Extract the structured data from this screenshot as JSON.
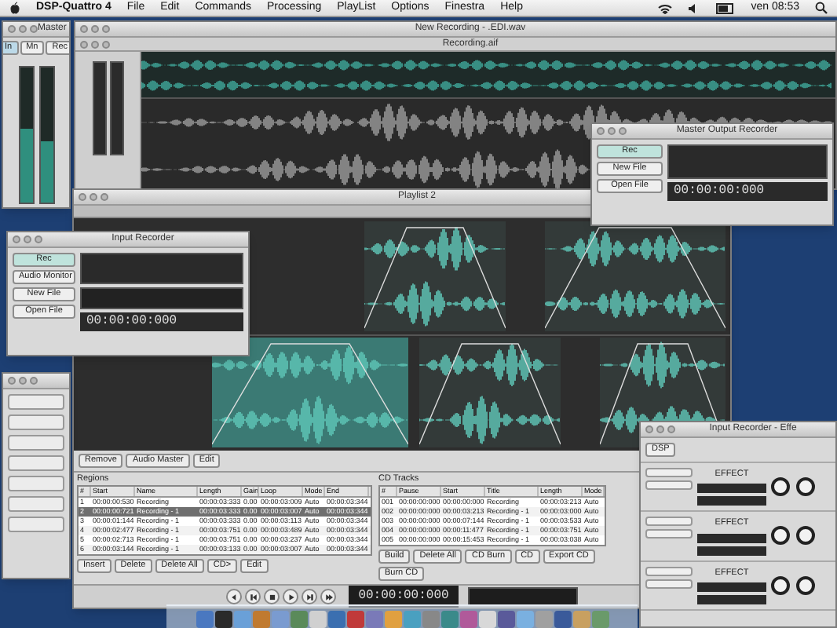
{
  "menu_bar": {
    "app": "DSP-Quattro 4",
    "items": [
      "File",
      "Edit",
      "Commands",
      "Processing",
      "PlayList",
      "Options",
      "Finestra",
      "Help"
    ],
    "clock": "ven 08:53"
  },
  "master_window": {
    "title": "Master",
    "buttons": [
      "In",
      "Mn",
      "Rec"
    ],
    "meters": [
      {
        "level": 0.55
      },
      {
        "level": 0.45
      }
    ]
  },
  "editor_window": {
    "title": "New Recording - .EDI.wav",
    "subtitle": "Recording.aif"
  },
  "output_recorder": {
    "title": "Master Output Recorder",
    "buttons": [
      "Rec",
      "New File",
      "Open File"
    ],
    "time": "00:00:00:000"
  },
  "playlist_window": {
    "title": "Playlist 2",
    "tabs": [
      {
        "label": "Remove",
        "selected": false
      },
      {
        "label": "Audio Master",
        "selected": false
      },
      {
        "label": "Edit",
        "selected": false
      }
    ],
    "regions": {
      "title": "Regions",
      "columns": [
        "#",
        "Start",
        "Name",
        "Length",
        "Gain",
        "Loop",
        "Mode",
        "End"
      ],
      "rows": [
        {
          "cells": [
            "1",
            "00:00:00:530",
            "Recording",
            "00:00:03:333",
            "0.00",
            "00:00:03:009",
            "Auto",
            "00:00:03:344"
          ],
          "selected": false
        },
        {
          "cells": [
            "2",
            "00:00:00:721",
            "Recording - 1",
            "00:00:03:333",
            "0.00",
            "00:00:03:007",
            "Auto",
            "00:00:03:344"
          ],
          "selected": true
        },
        {
          "cells": [
            "3",
            "00:00:01:144",
            "Recording - 1",
            "00:00:03:333",
            "0.00",
            "00:00:03:113",
            "Auto",
            "00:00:03:344"
          ],
          "selected": false
        },
        {
          "cells": [
            "4",
            "00:00:02:477",
            "Recording - 1",
            "00:00:03:751",
            "0.00",
            "00:00:03:489",
            "Auto",
            "00:00:03:344"
          ],
          "selected": false
        },
        {
          "cells": [
            "5",
            "00:00:02:713",
            "Recording - 1",
            "00:00:03:751",
            "0.00",
            "00:00:03:237",
            "Auto",
            "00:00:03:344"
          ],
          "selected": false
        },
        {
          "cells": [
            "6",
            "00:00:03:144",
            "Recording - 1",
            "00:00:03:133",
            "0.00",
            "00:00:03:007",
            "Auto",
            "00:00:03:344"
          ],
          "selected": false
        }
      ],
      "buttons": [
        "Insert",
        "Delete",
        "Delete All",
        "CD>",
        "Edit"
      ]
    },
    "cd_tracks": {
      "title": "CD Tracks",
      "columns": [
        "#",
        "Pause",
        "Start",
        "Title",
        "Length",
        "Mode"
      ],
      "rows": [
        {
          "cells": [
            "001",
            "00:00:00:000",
            "00:00:00:000",
            "Recording",
            "00:00:03:213",
            "Auto"
          ],
          "selected": false
        },
        {
          "cells": [
            "002",
            "00:00:00:000",
            "00:00:03:213",
            "Recording - 1",
            "00:00:03:000",
            "Auto"
          ],
          "selected": false
        },
        {
          "cells": [
            "003",
            "00:00:00:000",
            "00:00:07:144",
            "Recording - 1",
            "00:00:03:533",
            "Auto"
          ],
          "selected": false
        },
        {
          "cells": [
            "004",
            "00:00:00:000",
            "00:00:11:477",
            "Recording - 1",
            "00:00:03:751",
            "Auto"
          ],
          "selected": false
        },
        {
          "cells": [
            "005",
            "00:00:00:000",
            "00:00:15:453",
            "Recording - 1",
            "00:00:03:038",
            "Auto"
          ],
          "selected": false
        }
      ],
      "buttons": [
        "Build",
        "Delete All",
        "CD Burn",
        "CD",
        "Export CD",
        "Burn CD"
      ]
    },
    "time": "00:00:00:000"
  },
  "input_recorder": {
    "title": "Input Recorder",
    "buttons": [
      "Rec",
      "Audio Monitor",
      "New File",
      "Open File"
    ],
    "time": "00:00:00:000"
  },
  "effects_window": {
    "title": "Input Recorder - Effe",
    "top_button": "DSP",
    "slots": [
      {
        "label": "EFFECT"
      },
      {
        "label": "EFFECT"
      },
      {
        "label": "EFFECT"
      }
    ]
  }
}
